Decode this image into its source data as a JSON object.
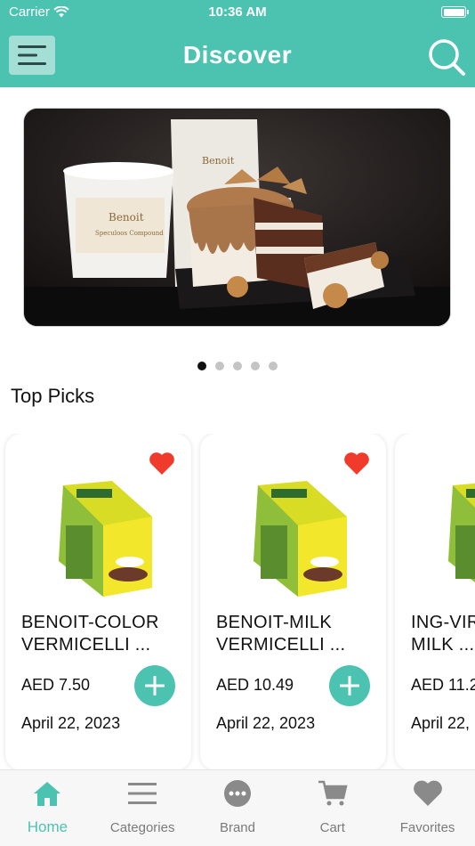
{
  "status_bar": {
    "carrier": "Carrier",
    "time": "10:36 AM"
  },
  "header": {
    "title": "Discover"
  },
  "banner": {
    "slides": 5,
    "active_index": 0,
    "brand_text": "Benoit"
  },
  "section": {
    "title": "Top Picks"
  },
  "products": [
    {
      "name": "BENOIT-COLOR\nVERMICELLI ...",
      "price": "AED 7.50",
      "date": "April 22, 2023",
      "favorited": true
    },
    {
      "name": "BENOIT-MILK\nVERMICELLI  ...",
      "price": "AED 10.49",
      "date": "April 22, 2023",
      "favorited": true
    },
    {
      "name": "ING-VIR\nMILK ...",
      "price": "AED 11.2",
      "date": "April 22,",
      "favorited": false
    }
  ],
  "tabs": [
    {
      "label": "Home",
      "icon": "home-icon",
      "active": true
    },
    {
      "label": "Categories",
      "icon": "categories-icon",
      "active": false
    },
    {
      "label": "Brand",
      "icon": "brand-icon",
      "active": false
    },
    {
      "label": "Cart",
      "icon": "cart-icon",
      "active": false
    },
    {
      "label": "Favorites",
      "icon": "favorites-icon",
      "active": false
    }
  ],
  "colors": {
    "accent": "#4cc3b1",
    "heart": "#f03a2b",
    "inactive": "#8a8a8a"
  }
}
